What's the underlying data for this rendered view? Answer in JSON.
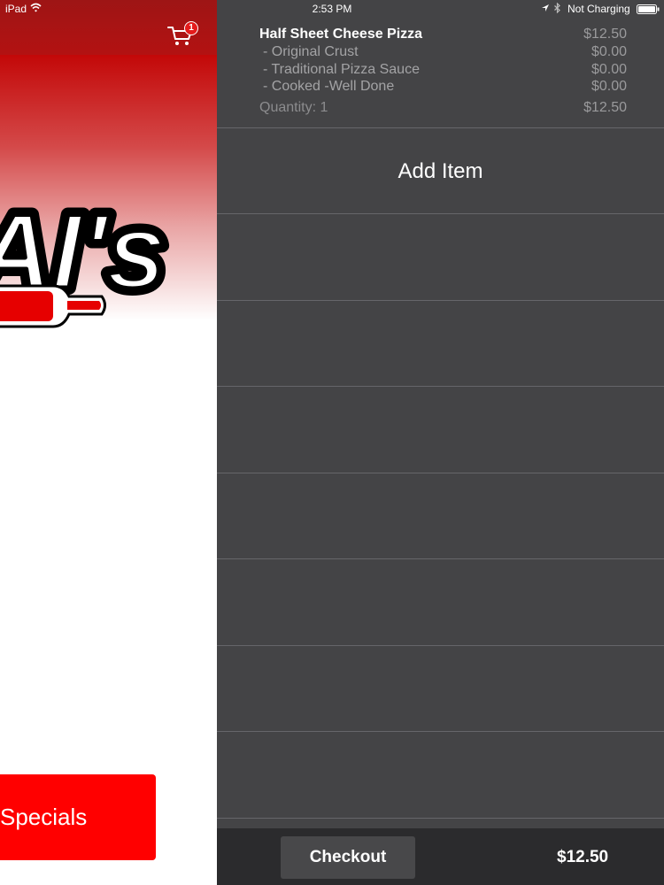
{
  "status_bar": {
    "carrier": "iPad",
    "time": "2:53 PM",
    "battery_text": "Not Charging"
  },
  "header": {
    "cart_badge_count": "1",
    "cart_icon": "shopping-cart-icon"
  },
  "logo": {
    "text": "AI's"
  },
  "main": {
    "specials_label": "Specials"
  },
  "cart": {
    "item": {
      "name": "Half Sheet Cheese Pizza",
      "price": "$12.50",
      "modifiers": [
        {
          "label": "- Original Crust",
          "price": "$0.00"
        },
        {
          "label": "- Traditional Pizza Sauce",
          "price": "$0.00"
        },
        {
          "label": "- Cooked -Well Done",
          "price": "$0.00"
        }
      ],
      "quantity_label": "Quantity: 1",
      "line_total": "$12.50"
    },
    "add_item_label": "Add Item"
  },
  "footer": {
    "checkout_label": "Checkout",
    "total": "$12.50"
  },
  "colors": {
    "header_red": "#b31212",
    "button_red": "#ff0000",
    "panel_bg": "#444446",
    "footer_bg": "#2b2b2d"
  }
}
